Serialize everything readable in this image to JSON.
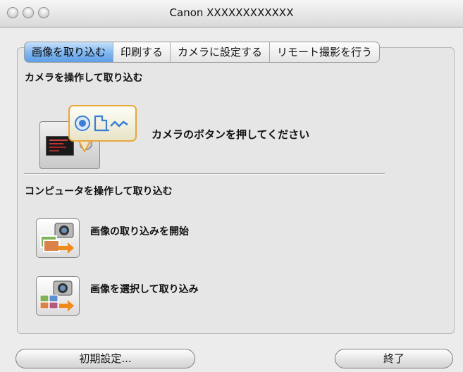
{
  "window": {
    "title": "Canon XXXXXXXXXXXX"
  },
  "tabs": [
    {
      "label": "画像を取り込む",
      "active": true
    },
    {
      "label": "印刷する",
      "active": false
    },
    {
      "label": "カメラに設定する",
      "active": false
    },
    {
      "label": "リモート撮影を行う",
      "active": false
    }
  ],
  "camera_section": {
    "heading": "カメラを操作して取り込む",
    "instruction": "カメラのボタンを押してください"
  },
  "computer_section": {
    "heading": "コンピュータを操作して取り込む",
    "actions": [
      {
        "label": "画像の取り込みを開始"
      },
      {
        "label": "画像を選択して取り込み"
      }
    ]
  },
  "footer": {
    "preferences_label": "初期設定...",
    "quit_label": "終了"
  },
  "colors": {
    "tab_active": "#7fb6ef",
    "bubble_border": "#e9a63a",
    "icon_blue": "#3b7fd4",
    "arrow_orange": "#f08a1a"
  }
}
